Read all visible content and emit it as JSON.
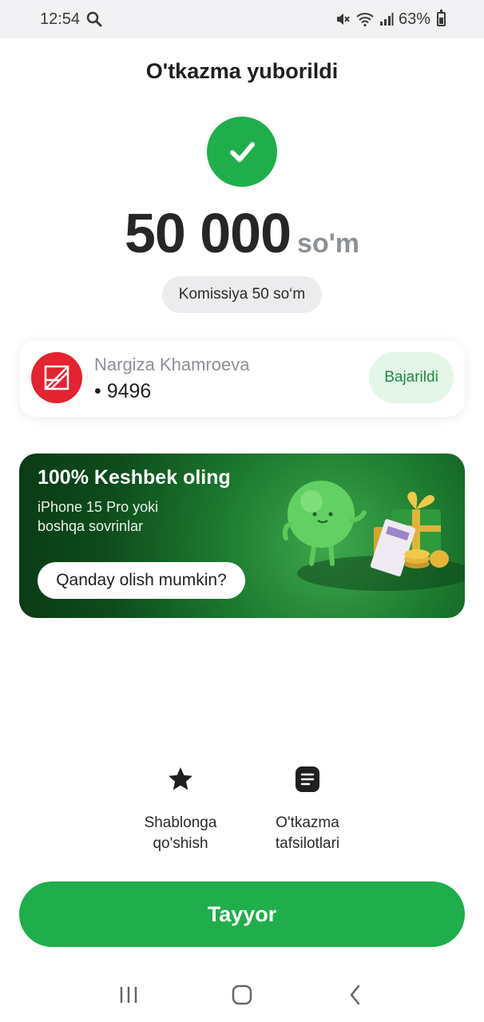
{
  "status_bar": {
    "time": "12:54",
    "battery": "63%",
    "icons": [
      "search-icon",
      "mute-icon",
      "wifi-icon",
      "signal-icon",
      "battery-icon"
    ]
  },
  "header": {
    "title": "O'tkazma yuborildi"
  },
  "transfer": {
    "amount": "50 000",
    "currency": "so'm",
    "fee": "Komissiya 50 so‘m"
  },
  "recipient": {
    "name": "Nargiza Khamroeva",
    "card": "• 9496",
    "status": "Bajarildi"
  },
  "promo": {
    "title": "100% Keshbek oling",
    "subtitle": "iPhone 15 Pro yoki\nboshqa sovrinlar",
    "button": "Qanday olish mumkin?"
  },
  "actions": {
    "template": "Shablonga\nqo'shish",
    "details": "O'tkazma\ntafsilotlari"
  },
  "done_button": "Tayyor",
  "colors": {
    "accent": "#1fae4b",
    "bank_logo": "#e5222f",
    "status_chip_bg": "#e3f6e8",
    "status_chip_text": "#1f8e3f"
  }
}
